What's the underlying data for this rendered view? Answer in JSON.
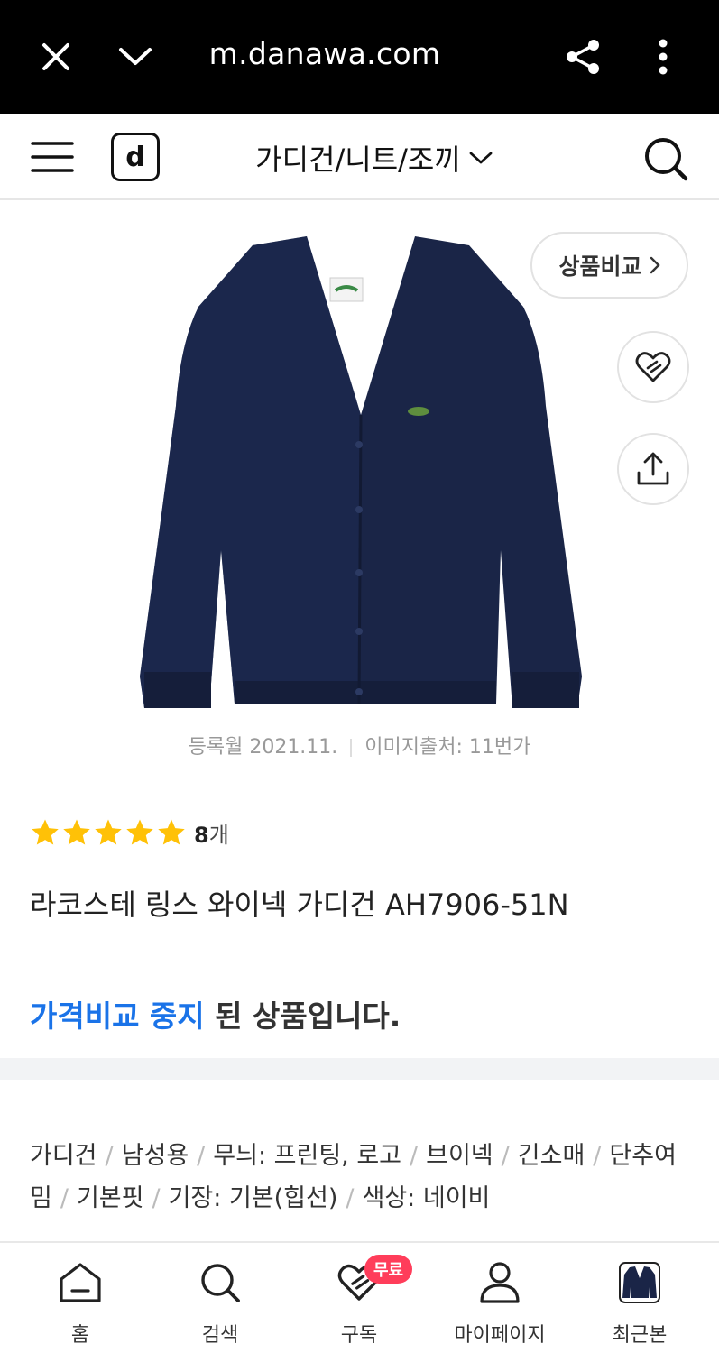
{
  "browser": {
    "url": "m.danawa.com"
  },
  "header": {
    "logo_letter": "d",
    "category": "가디건/니트/조끼"
  },
  "product": {
    "image_alt": "navy cardigan",
    "compare_label": "상품비교",
    "registered": "등록월 2021.11.",
    "image_source": "이미지출처: 11번가",
    "rating_stars": 5,
    "review_count": "8",
    "review_unit": "개",
    "title": "라코스테 링스 와이넥 가디건 AH7906-51N",
    "notice_highlight": "가격비교 중지",
    "notice_rest": " 된 상품입니다.",
    "specs": [
      "가디건",
      "남성용",
      "무늬: 프린팅, 로고",
      "브이넥",
      "긴소매",
      "단추여밈",
      "기본핏",
      "기장: 기본(힙선)",
      "색상: 네이비"
    ]
  },
  "bottom_nav": {
    "items": [
      {
        "label": "홈",
        "icon": "home-icon"
      },
      {
        "label": "검색",
        "icon": "search-icon"
      },
      {
        "label": "구독",
        "icon": "heart-icon",
        "badge": "무료"
      },
      {
        "label": "마이페이지",
        "icon": "user-icon"
      },
      {
        "label": "최근본",
        "icon": "recent-thumbnail"
      }
    ]
  },
  "colors": {
    "accent_blue": "#1a73e8",
    "star_yellow": "#ffc107",
    "badge_red": "#ff3d5a",
    "cardigan_navy": "#1a2547"
  }
}
